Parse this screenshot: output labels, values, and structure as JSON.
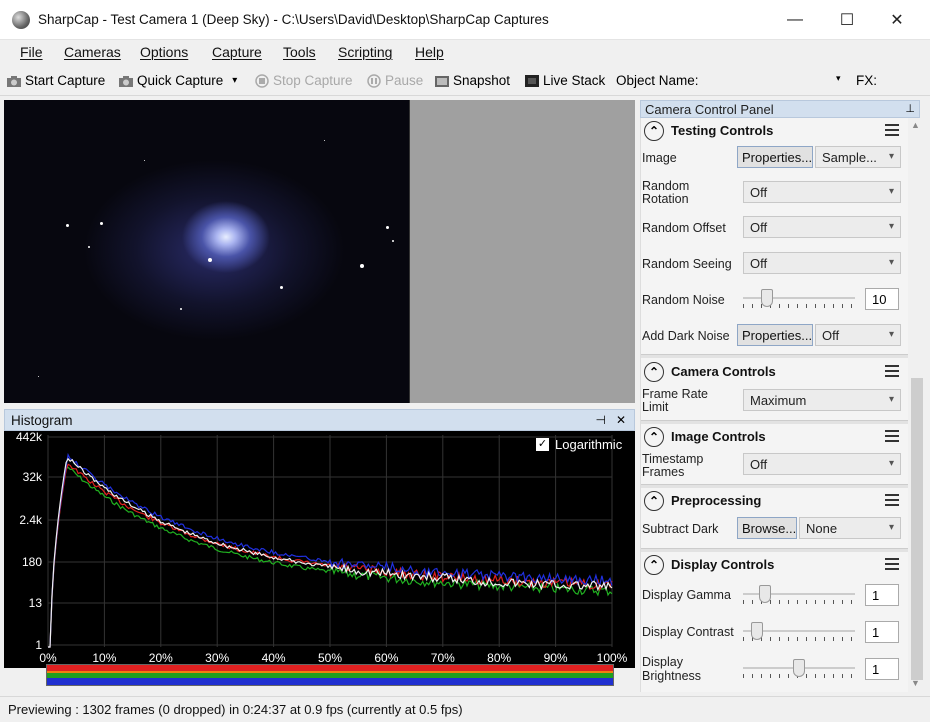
{
  "window": {
    "title": "SharpCap - Test Camera 1 (Deep Sky) - C:\\Users\\David\\Desktop\\SharpCap Captures",
    "minimize": "—",
    "maximize": "☐",
    "close": "✕"
  },
  "menu": [
    "File",
    "Cameras",
    "Options",
    "Capture",
    "Tools",
    "Scripting",
    "Help"
  ],
  "toolbar": {
    "start_capture": "Start Capture",
    "quick_capture": "Quick Capture",
    "quick_capture_arrow": "▾",
    "stop_capture": "Stop Capture",
    "pause": "Pause",
    "snapshot": "Snapshot",
    "live_stack": "Live Stack",
    "object_name": "Object Name:",
    "fx": "FX:",
    "object_name_arrow": "▾"
  },
  "histogram": {
    "title": "Histogram",
    "pin": "⊣",
    "close": "✕",
    "logarithmic_label": "Logarithmic",
    "logarithmic_checked": true,
    "y_ticks": [
      "442k",
      "32k",
      "2.4k",
      "180",
      "13",
      "1"
    ],
    "x_ticks": [
      "0%",
      "10%",
      "20%",
      "30%",
      "40%",
      "50%",
      "60%",
      "70%",
      "80%",
      "90%",
      "100%"
    ],
    "colors": {
      "red": "#e02020",
      "green": "#20b020",
      "blue": "#2030e0",
      "white": "#f0f0f0"
    }
  },
  "status": "Previewing : 1302 frames (0 dropped) in 0:24:37 at 0.9 fps  (currently at 0.5 fps)",
  "camera_panel": {
    "title": "Camera Control Panel",
    "pin": "⊥",
    "sections": {
      "testing": {
        "label": "Testing Controls",
        "image_label": "Image",
        "properties_btn": "Properties...",
        "sample_value": "Sample...",
        "rotation_label_1": "Random",
        "rotation_label_2": "Rotation",
        "rotation_value": "Off",
        "offset_label": "Random Offset",
        "offset_value": "Off",
        "seeing_label": "Random Seeing",
        "seeing_value": "Off",
        "noise_label": "Random Noise",
        "noise_value": "10",
        "dark_noise_label": "Add Dark Noise",
        "dark_properties_btn": "Properties...",
        "dark_noise_value": "Off"
      },
      "camera": {
        "label": "Camera Controls",
        "frame_rate_label_1": "Frame Rate",
        "frame_rate_label_2": "Limit",
        "frame_rate_value": "Maximum"
      },
      "image": {
        "label": "Image Controls",
        "timestamp_label_1": "Timestamp",
        "timestamp_label_2": "Frames",
        "timestamp_value": "Off"
      },
      "preprocessing": {
        "label": "Preprocessing",
        "subtract_dark_label": "Subtract Dark",
        "browse_btn": "Browse...",
        "subtract_dark_value": "None"
      },
      "display": {
        "label": "Display Controls",
        "gamma_label": "Display Gamma",
        "gamma_value": "1",
        "contrast_label": "Display Contrast",
        "contrast_value": "1",
        "brightness_label_1": "Display",
        "brightness_label_2": "Brightness",
        "brightness_value": "1"
      }
    }
  }
}
